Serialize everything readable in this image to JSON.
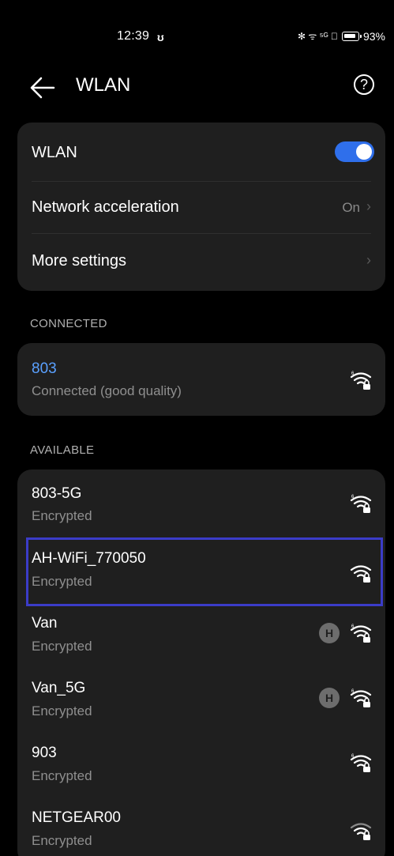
{
  "status": {
    "time": "12:39",
    "time_icon": "ʊ",
    "signals": "✻ ᯤ ⁵ᴳ ᪲",
    "battery_pct": "93%"
  },
  "header": {
    "title": "WLAN",
    "help": "?"
  },
  "settings": {
    "wlan_label": "WLAN",
    "wlan_enabled": true,
    "accel_label": "Network acceleration",
    "accel_value": "On",
    "more_label": "More settings"
  },
  "connected": {
    "section_label": "CONNECTED",
    "name": "803",
    "status": "Connected (good quality)"
  },
  "available": {
    "section_label": "AVAILABLE",
    "networks": [
      {
        "name": "803-5G",
        "security": "Encrypted"
      },
      {
        "name": "AH-WiFi_770050",
        "security": "Encrypted"
      },
      {
        "name": "Van",
        "security": "Encrypted"
      },
      {
        "name": "Van_5G",
        "security": "Encrypted"
      },
      {
        "name": "903",
        "security": "Encrypted"
      },
      {
        "name": "NETGEAR00",
        "security": "Encrypted"
      }
    ]
  },
  "colors": {
    "accent": "#2f6feb",
    "link": "#5aa0ff",
    "highlight": "#3b3cc8"
  }
}
